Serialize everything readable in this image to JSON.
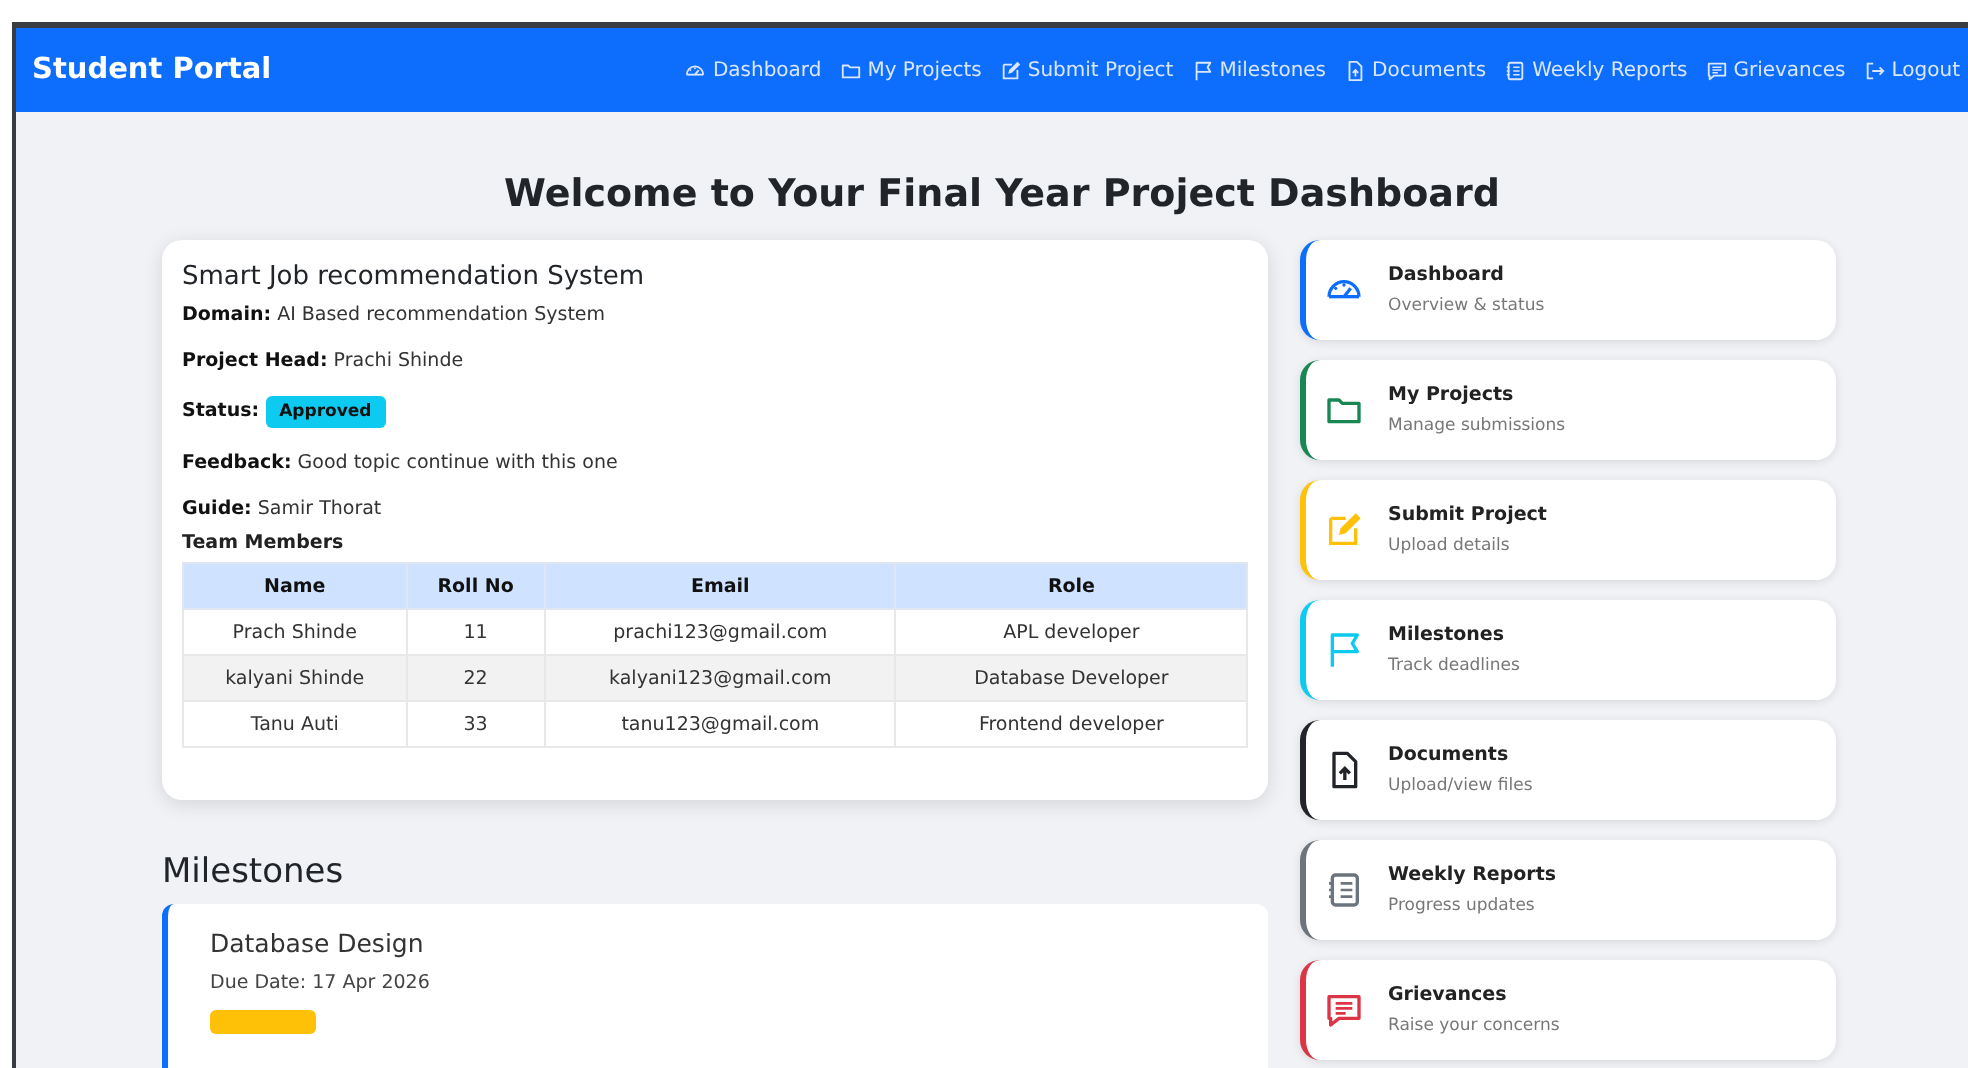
{
  "brand": "Student Portal",
  "nav": [
    {
      "label": "Dashboard",
      "kind": "gauge"
    },
    {
      "label": "My Projects",
      "kind": "folder"
    },
    {
      "label": "Submit Project",
      "kind": "edit"
    },
    {
      "label": "Milestones",
      "kind": "flag"
    },
    {
      "label": "Documents",
      "kind": "document"
    },
    {
      "label": "Weekly Reports",
      "kind": "report"
    },
    {
      "label": "Grievances",
      "kind": "chat"
    },
    {
      "label": "Logout",
      "kind": "logout"
    }
  ],
  "heading": "Welcome to Your Final Year Project Dashboard",
  "project": {
    "title": "Smart Job recommendation System",
    "fields": [
      {
        "label": "Domain:",
        "value": "AI Based recommendation System"
      },
      {
        "label": "Project Head:",
        "value": "Prachi Shinde"
      },
      {
        "label": "Status:",
        "value": "Approved",
        "kind": "badge"
      },
      {
        "label": "Feedback:",
        "value": "Good topic continue with this one"
      },
      {
        "label": "Guide:",
        "value": "Samir Thorat"
      }
    ],
    "team_heading": "Team Members",
    "table": {
      "columns": [
        "Name",
        "Roll No",
        "Email",
        "Role"
      ],
      "rows": [
        [
          "Prach Shinde",
          "11",
          "prachi123@gmail.com",
          "APL developer"
        ],
        [
          "kalyani Shinde",
          "22",
          "kalyani123@gmail.com",
          "Database Developer"
        ],
        [
          "Tanu Auti",
          "33",
          "tanu123@gmail.com",
          "Frontend developer"
        ]
      ]
    }
  },
  "milestones_heading": "Milestones",
  "milestones": [
    {
      "title": "Database Design",
      "due": "Due Date: 17 Apr 2026",
      "color": "#ffc107"
    }
  ],
  "quick_links": [
    {
      "title": "Dashboard",
      "subtitle": "Overview & status",
      "kind": "gauge",
      "color": "#0d6efd"
    },
    {
      "title": "My Projects",
      "subtitle": "Manage submissions",
      "kind": "folder",
      "color": "#198754"
    },
    {
      "title": "Submit Project",
      "subtitle": "Upload details",
      "kind": "edit",
      "color": "#ffc107"
    },
    {
      "title": "Milestones",
      "subtitle": "Track deadlines",
      "kind": "flag",
      "color": "#0dcaf0"
    },
    {
      "title": "Documents",
      "subtitle": "Upload/view files",
      "kind": "document",
      "color": "#212529"
    },
    {
      "title": "Weekly Reports",
      "subtitle": "Progress updates",
      "kind": "report",
      "color": "#6c757d"
    },
    {
      "title": "Grievances",
      "subtitle": "Raise your concerns",
      "kind": "chat",
      "color": "#dc3545"
    }
  ]
}
